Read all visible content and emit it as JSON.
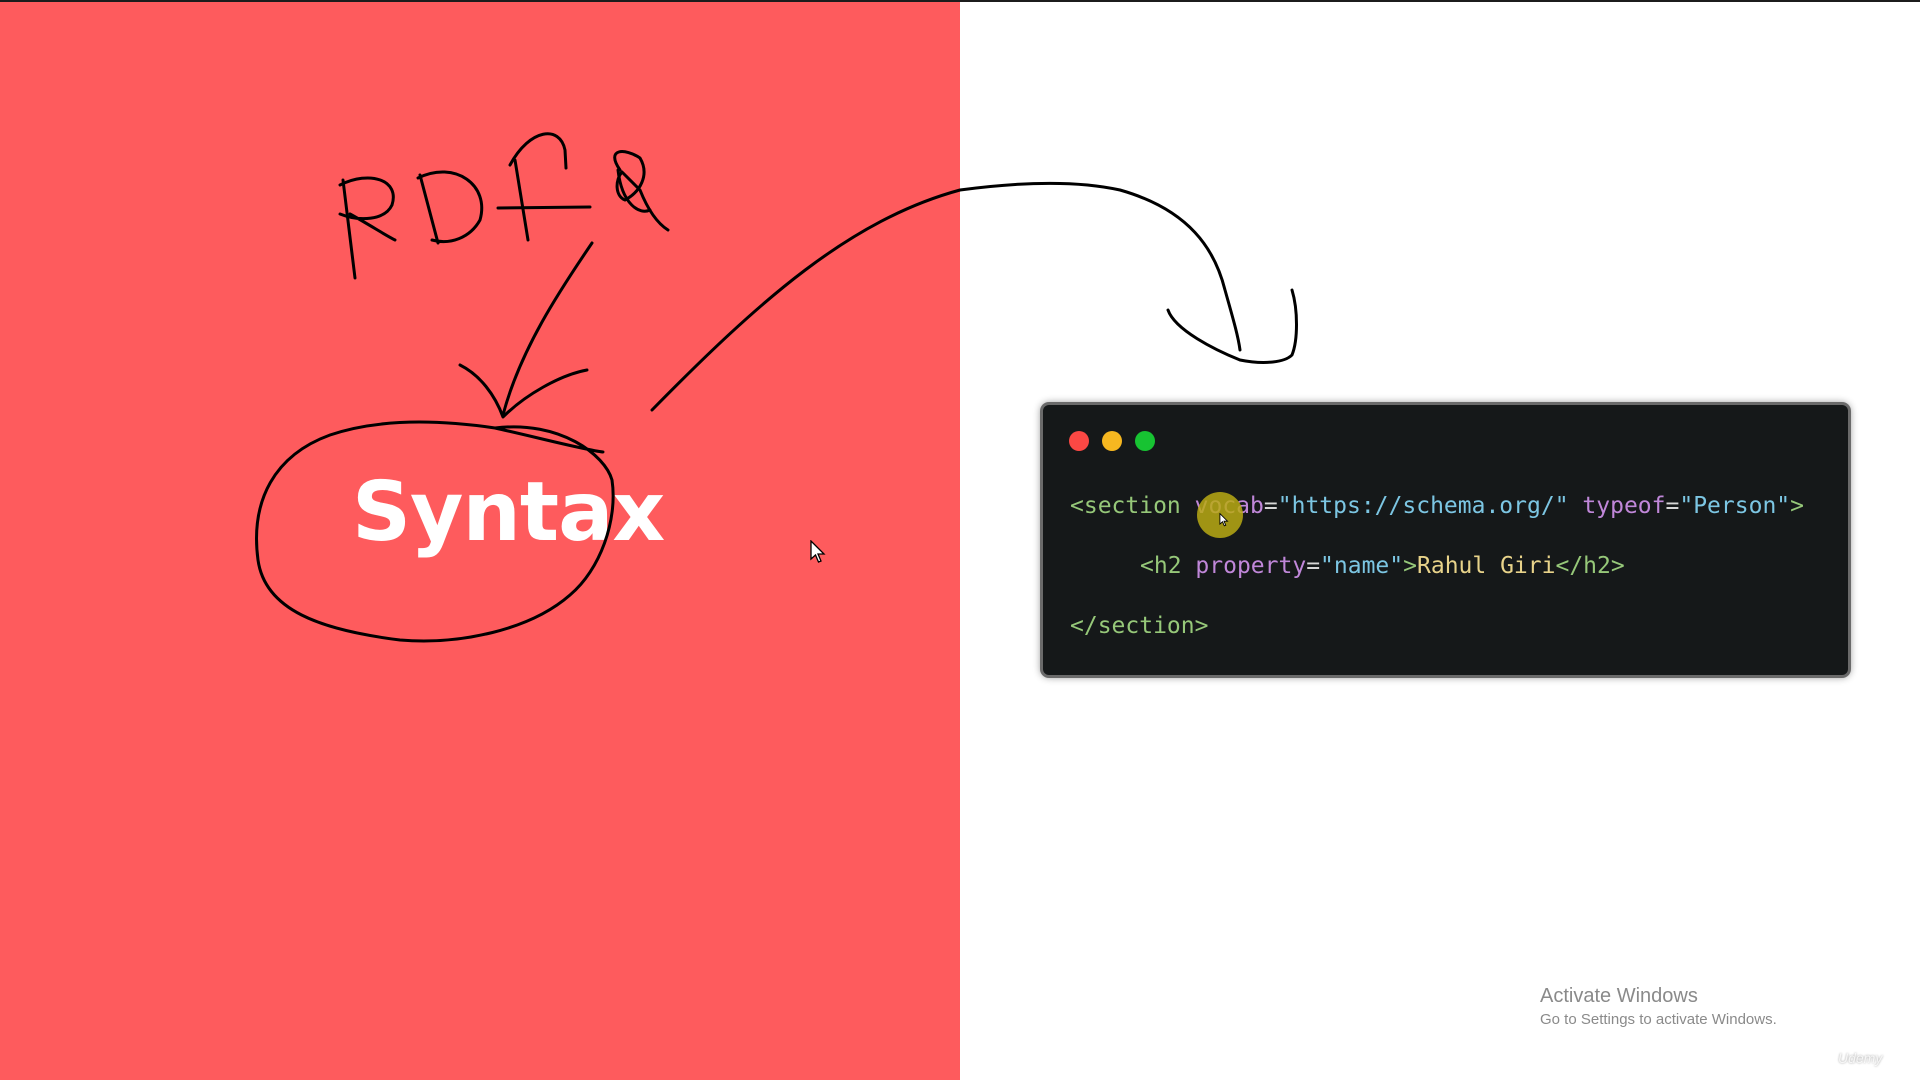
{
  "slide": {
    "title": "Syntax",
    "handwriting": "RDFa",
    "left_color": "#fe5b5d",
    "right_color": "#ffffff"
  },
  "code_window": {
    "buttons": [
      "close",
      "minimize",
      "maximize"
    ],
    "line1": {
      "tag_open": "<section",
      "attr1_name": "vocab",
      "attr1_eq": "=",
      "attr1_value": "\"https://schema.org/\"",
      "attr2_name": "typeof",
      "attr2_eq": "=",
      "attr2_value": "\"Person\"",
      "tag_close": ">"
    },
    "line2": {
      "tag_open": "<h2",
      "attr_name": "property",
      "attr_eq": "=",
      "attr_value": "\"name\"",
      "tag_close": ">",
      "text": "Rahul Giri",
      "end_tag": "</h2>"
    },
    "line3": {
      "end_tag": "</section>"
    }
  },
  "os_notice": {
    "title": "Activate Windows",
    "subtitle": "Go to Settings to activate Windows."
  },
  "watermark": "Udemy"
}
